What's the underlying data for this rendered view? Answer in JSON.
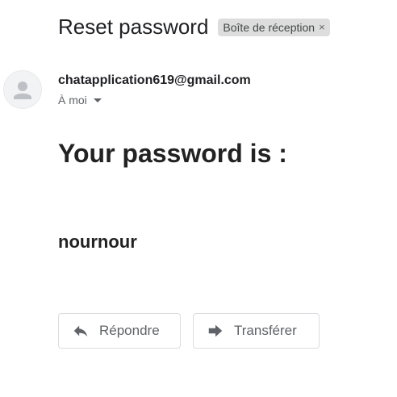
{
  "email": {
    "subject": "Reset password",
    "label": "Boîte de réception",
    "label_close": "×",
    "sender": "chatapplication619@gmail.com",
    "recipient": "À moi",
    "body": {
      "heading": "Your password is :",
      "password": "nournour"
    }
  },
  "actions": {
    "reply_label": "Répondre",
    "forward_label": "Transférer"
  },
  "icons": {
    "avatar": "person-icon",
    "reply": "reply-icon",
    "forward": "forward-icon",
    "caret": "chevron-down-icon"
  },
  "colors": {
    "text": "#202124",
    "muted": "#5f6368",
    "badge_bg": "#dddddd",
    "border": "#dadce0"
  }
}
